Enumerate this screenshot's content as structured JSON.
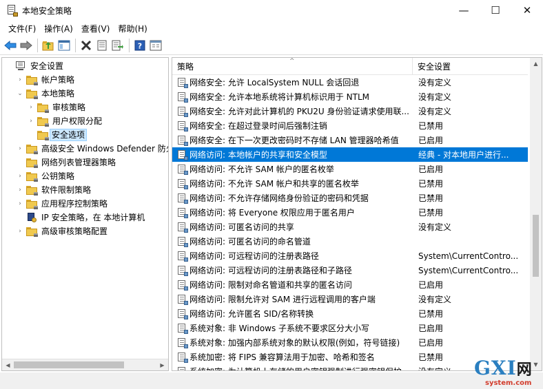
{
  "window": {
    "title": "本地安全策略",
    "minimize": "—",
    "maximize": "☐",
    "close": "✕"
  },
  "menu": [
    "文件(F)",
    "操作(A)",
    "查看(V)",
    "帮助(H)"
  ],
  "toolbar_icons": [
    "back-arrow-icon",
    "forward-arrow-icon",
    "up-folder-icon",
    "show-hide-tree-icon",
    "delete-icon",
    "properties-icon",
    "export-list-icon",
    "help-icon",
    "console-tree-icon"
  ],
  "tree": [
    {
      "label": "安全设置",
      "indent": 0,
      "chevron": "",
      "icon": "pc",
      "selected": false
    },
    {
      "label": "帐户策略",
      "indent": 1,
      "chevron": "›",
      "icon": "folder",
      "selected": false
    },
    {
      "label": "本地策略",
      "indent": 1,
      "chevron": "⌄",
      "icon": "folder",
      "selected": false
    },
    {
      "label": "审核策略",
      "indent": 2,
      "chevron": "›",
      "icon": "folder",
      "selected": false
    },
    {
      "label": "用户权限分配",
      "indent": 2,
      "chevron": "›",
      "icon": "folder",
      "selected": false
    },
    {
      "label": "安全选项",
      "indent": 2,
      "chevron": "",
      "icon": "folder",
      "selected": true
    },
    {
      "label": "高级安全 Windows Defender 防火墙",
      "indent": 1,
      "chevron": "›",
      "icon": "folder",
      "selected": false
    },
    {
      "label": "网络列表管理器策略",
      "indent": 1,
      "chevron": "",
      "icon": "folder",
      "selected": false
    },
    {
      "label": "公钥策略",
      "indent": 1,
      "chevron": "›",
      "icon": "folder",
      "selected": false
    },
    {
      "label": "软件限制策略",
      "indent": 1,
      "chevron": "›",
      "icon": "folder",
      "selected": false
    },
    {
      "label": "应用程序控制策略",
      "indent": 1,
      "chevron": "›",
      "icon": "folder",
      "selected": false
    },
    {
      "label": "IP 安全策略，在 本地计算机",
      "indent": 1,
      "chevron": "",
      "icon": "ip",
      "selected": false
    },
    {
      "label": "高级审核策略配置",
      "indent": 1,
      "chevron": "›",
      "icon": "folder",
      "selected": false
    }
  ],
  "list": {
    "columns": [
      "策略",
      "安全设置"
    ],
    "sort_indicator": "^",
    "rows": [
      {
        "policy": "网络安全: 允许 LocalSystem NULL 会话回退",
        "setting": "没有定义",
        "selected": false
      },
      {
        "policy": "网络安全: 允许本地系统将计算机标识用于 NTLM",
        "setting": "没有定义",
        "selected": false
      },
      {
        "policy": "网络安全: 允许对此计算机的 PKU2U 身份验证请求使用联...",
        "setting": "没有定义",
        "selected": false
      },
      {
        "policy": "网络安全: 在超过登录时间后强制注销",
        "setting": "已禁用",
        "selected": false
      },
      {
        "policy": "网络安全: 在下一次更改密码时不存储 LAN 管理器哈希值",
        "setting": "已启用",
        "selected": false
      },
      {
        "policy": "网络访问: 本地帐户的共享和安全模型",
        "setting": "经典 - 对本地用户进行...",
        "selected": true
      },
      {
        "policy": "网络访问: 不允许 SAM 帐户的匿名枚举",
        "setting": "已启用",
        "selected": false
      },
      {
        "policy": "网络访问: 不允许 SAM 帐户和共享的匿名枚举",
        "setting": "已禁用",
        "selected": false
      },
      {
        "policy": "网络访问: 不允许存储网络身份验证的密码和凭据",
        "setting": "已禁用",
        "selected": false
      },
      {
        "policy": "网络访问: 将 Everyone 权限应用于匿名用户",
        "setting": "已禁用",
        "selected": false
      },
      {
        "policy": "网络访问: 可匿名访问的共享",
        "setting": "没有定义",
        "selected": false
      },
      {
        "policy": "网络访问: 可匿名访问的命名管道",
        "setting": "",
        "selected": false
      },
      {
        "policy": "网络访问: 可远程访问的注册表路径",
        "setting": "System\\CurrentContro...",
        "selected": false
      },
      {
        "policy": "网络访问: 可远程访问的注册表路径和子路径",
        "setting": "System\\CurrentContro...",
        "selected": false
      },
      {
        "policy": "网络访问: 限制对命名管道和共享的匿名访问",
        "setting": "已启用",
        "selected": false
      },
      {
        "policy": "网络访问: 限制允许对 SAM 进行远程调用的客户端",
        "setting": "没有定义",
        "selected": false
      },
      {
        "policy": "网络访问: 允许匿名 SID/名称转换",
        "setting": "已禁用",
        "selected": false
      },
      {
        "policy": "系统对象: 非 Windows 子系统不要求区分大小写",
        "setting": "已启用",
        "selected": false
      },
      {
        "policy": "系统对象: 加强内部系统对象的默认权限(例如，符号链接)",
        "setting": "已启用",
        "selected": false
      },
      {
        "policy": "系统加密: 将 FIPS 兼容算法用于加密、哈希和签名",
        "setting": "已禁用",
        "selected": false
      },
      {
        "policy": "系统加密: 为计算机上存储的用户密钥强制进行强密钥保护",
        "setting": "没有定义",
        "selected": false
      }
    ]
  },
  "watermark": {
    "main": "GXI",
    "net": "网",
    "sub": "system.com"
  }
}
